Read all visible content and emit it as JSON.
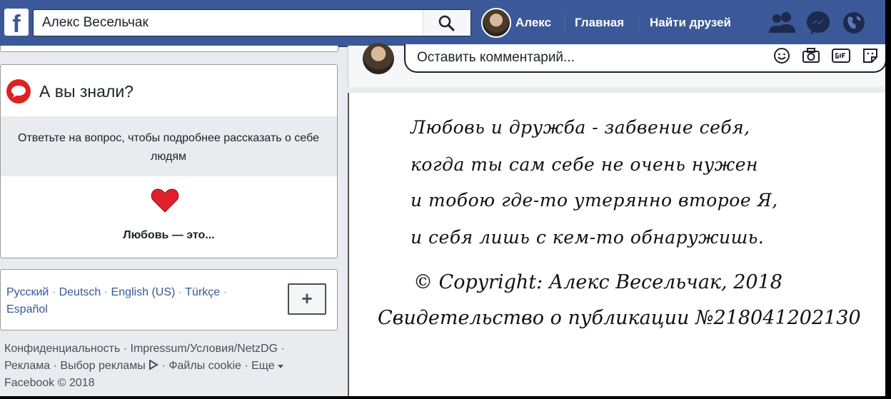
{
  "topbar": {
    "logo": "f",
    "search_value": "Алекс Весельчак",
    "user_name": "Алекс",
    "nav_home": "Главная",
    "nav_find_friends": "Найти друзей",
    "icons": [
      "friends-icon",
      "messenger-icon",
      "globe-icon"
    ]
  },
  "did_you_know": {
    "title": "А вы знали?",
    "description": "Ответьте на вопрос, чтобы подробнее рассказать о себе людям",
    "prompt": "Любовь — это..."
  },
  "languages": {
    "items": [
      "Русский",
      "Deutsch",
      "English (US)",
      "Türkçe",
      "Español"
    ],
    "add_label": "+"
  },
  "footer": {
    "links_line1": "Конфиденциальность · Impressum/Условия/NetzDG ·",
    "links_line2_a": "Реклама · Выбор рекламы",
    "links_line2_b": "· Файлы cookie · Еще",
    "copyright": "Facebook © 2018"
  },
  "comment": {
    "placeholder": "Оставить комментарий..."
  },
  "post": {
    "lines": [
      "Любовь и дружба - забвение себя,",
      "когда ты сам себе не очень нужен",
      "и тобою где-то утерянно второе Я,",
      "и себя лишь с кем-то обнаружишь."
    ],
    "copyright": "© Copyright: Алекс Весельчак, 2018",
    "certificate": "Свидетельство о публикации №218041202130"
  },
  "colors": {
    "brand": "#3b5998",
    "background": "#e9ebee",
    "heart": "#e0202f"
  }
}
